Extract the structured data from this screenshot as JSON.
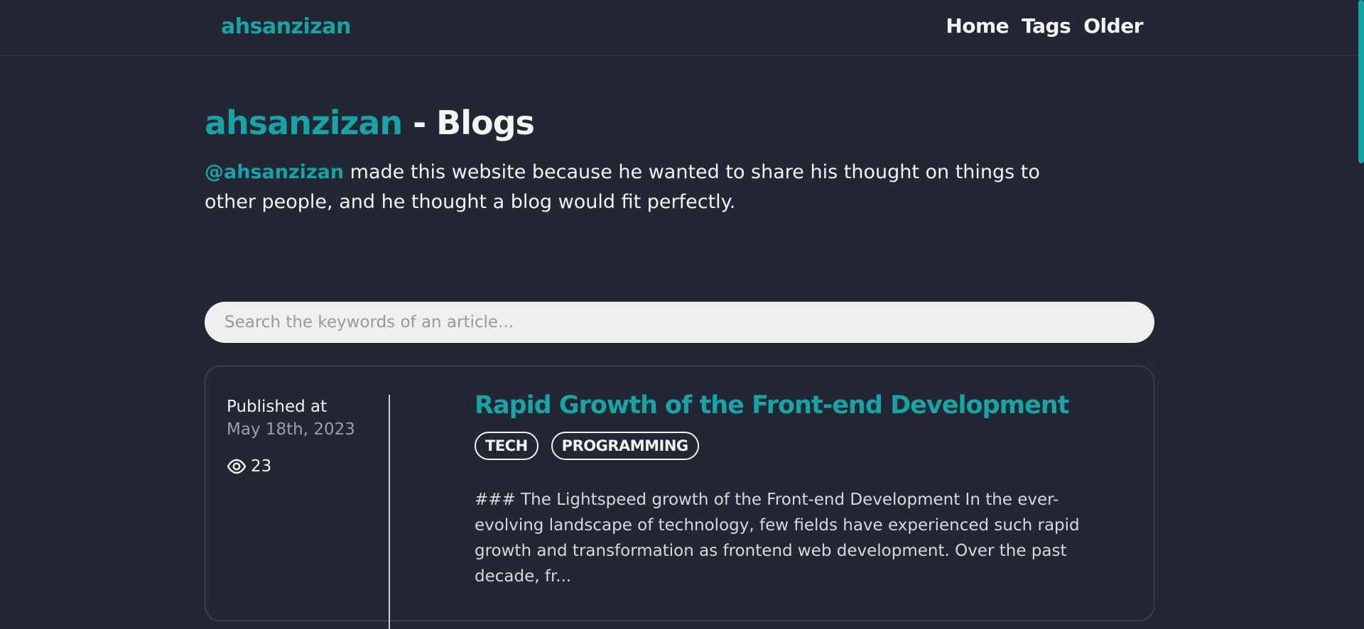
{
  "header": {
    "brand": "ahsanzizan",
    "nav": [
      "Home",
      "Tags",
      "Older"
    ]
  },
  "hero": {
    "title_accent": "ahsanzizan",
    "title_rest": " - Blogs",
    "intro_handle": "@ahsanzizan",
    "intro_text": " made this website because he wanted to share his thought on things to other people, and he thought a blog would fit perfectly."
  },
  "search": {
    "placeholder": "Search the keywords of an article...",
    "value": ""
  },
  "articles": [
    {
      "published_label": "Published at",
      "date": "May 18th, 2023",
      "views": "23",
      "title": "Rapid Growth of the Front-end Development",
      "tags": [
        "TECH",
        "PROGRAMMING"
      ],
      "excerpt": "### The Lightspeed growth of the Front-end Development In the ever-evolving landscape of technology, few fields have experienced such rapid growth and transformation as frontend web development. Over the past decade, fr..."
    }
  ],
  "icons": {
    "views": "eye-icon"
  },
  "colors": {
    "background": "#222733",
    "accent": "#18a3a6",
    "text": "#f2f2f2",
    "search_bg": "#efefef"
  }
}
